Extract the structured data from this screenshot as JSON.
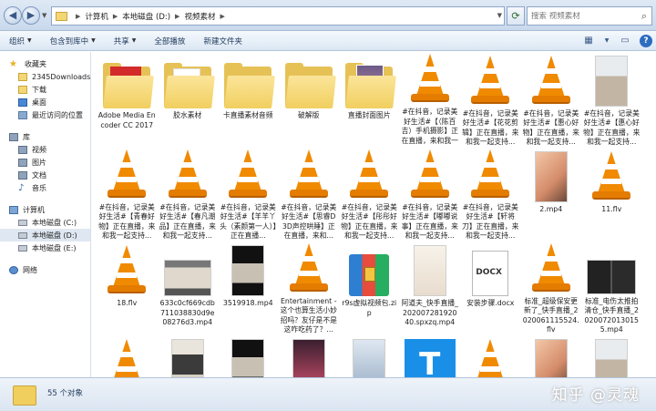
{
  "address": {
    "crumbs": [
      "计算机",
      "本地磁盘 (D:)",
      "视频素材"
    ],
    "search_placeholder": "搜索 视频素材"
  },
  "toolbar": {
    "organize": "组织",
    "include_library": "包含到库中",
    "share": "共享",
    "play_all": "全部播放",
    "new_folder": "新建文件夹"
  },
  "sidebar": {
    "favorites": {
      "label": "收藏夹",
      "items": [
        "2345Downloads",
        "下载",
        "桌面",
        "最近访问的位置"
      ]
    },
    "libraries": {
      "label": "库",
      "items": [
        "视频",
        "图片",
        "文档",
        "音乐"
      ]
    },
    "computer": {
      "label": "计算机",
      "items": [
        "本地磁盘 (C:)",
        "本地磁盘 (D:)",
        "本地磁盘 (E:)"
      ]
    },
    "network": {
      "label": "网络"
    }
  },
  "files": [
    {
      "name": "Adobe Media Encoder CC 2017",
      "icon": "folder-adobe"
    },
    {
      "name": "胶水素材",
      "icon": "folder-paper"
    },
    {
      "name": "卡直播素材音频",
      "icon": "folder"
    },
    {
      "name": "破解版",
      "icon": "folder"
    },
    {
      "name": "直播封面图片",
      "icon": "folder-pic"
    },
    {
      "name": "#在抖音，记录美好生活#【（陈百吉）手机摄影】正在直播，来和我一起支持...",
      "icon": "vlc"
    },
    {
      "name": "#在抖音，记录美好生活#【花花剪辑】正在直播，来和我一起支持...",
      "icon": "vlc"
    },
    {
      "name": "#在抖音，记录美好生活#【惠心好物】正在直播，来和我一起支持...",
      "icon": "vlc"
    },
    {
      "name": "#在抖音，记录美好生活#【惠心好物】正在直播，来和我一起支持...",
      "icon": "photo-p6"
    },
    {
      "name": "#在抖音，记录美好生活#【青春好物】正在直播，来和我一起支持...",
      "icon": "vlc"
    },
    {
      "name": "#在抖音，记录美好生活#【春凡潮品】正在直播，来和我一起支持...",
      "icon": "vlc"
    },
    {
      "name": "#在抖音，记录美好生活#【羊羊丫头（素颜第一人）】正在直播...",
      "icon": "vlc"
    },
    {
      "name": "#在抖音，记录美好生活#【思睿D3D声控哄睡】正在直播，来和...",
      "icon": "vlc"
    },
    {
      "name": "#在抖音，记录美好生活#【彤彤好物】正在直播，来和我一起支持...",
      "icon": "vlc"
    },
    {
      "name": "#在抖音，记录美好生活#【嘟嘟说事】正在直播，来和我一起支持...",
      "icon": "vlc"
    },
    {
      "name": "#在抖音，记录美好生活#【轩将刀】正在直播，来和我一起支持...",
      "icon": "vlc"
    },
    {
      "name": "2.mp4",
      "icon": "photo-p2"
    },
    {
      "name": "11.flv",
      "icon": "vlc"
    },
    {
      "name": "18.flv",
      "icon": "vlc"
    },
    {
      "name": "633c0cf669cdb711038830d9e08276d3.mp4",
      "icon": "photo-p3"
    },
    {
      "name": "3519918.mp4",
      "icon": "photo-p4"
    },
    {
      "name": "Entertainment - 这个也算生活小妙招吗？友仔是不是这咋吃药了？...",
      "icon": "vlc"
    },
    {
      "name": "r9s虚拟视频包.zip",
      "icon": "zip"
    },
    {
      "name": "阿道夫_快手直播_20200728192040.spxzq.mp4",
      "icon": "photo-p5"
    },
    {
      "name": "安装步骤.docx",
      "icon": "docx"
    },
    {
      "name": "标准_超级保安更新了_快手直播_2020061115524.flv",
      "icon": "vlc"
    },
    {
      "name": "标准_电伤太推拍清仓_快手直播_20200720130155.mp4",
      "icon": "photo-p7"
    },
    {
      "name": "",
      "icon": "vlc"
    },
    {
      "name": "",
      "icon": "photo-p1"
    },
    {
      "name": "",
      "icon": "photo-p4"
    },
    {
      "name": "",
      "icon": "photo-p9"
    },
    {
      "name": "",
      "icon": "photo-p8"
    },
    {
      "name": "",
      "icon": "tlogo"
    },
    {
      "name": "",
      "icon": "vlc"
    },
    {
      "name": "",
      "icon": "photo-p2"
    },
    {
      "name": "",
      "icon": "photo-p6"
    }
  ],
  "status": {
    "count": "55 个对象",
    "watermark": "知乎 @灵魂"
  }
}
